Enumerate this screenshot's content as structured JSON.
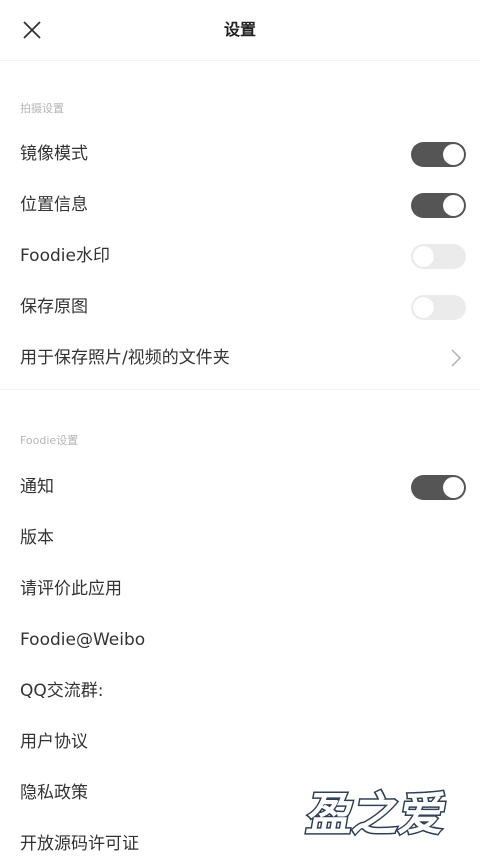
{
  "header": {
    "title": "设置",
    "close_icon": "close-icon"
  },
  "section_capture": {
    "label": "拍摄设置"
  },
  "capture_items": [
    {
      "label": "镜像模式",
      "toggle": true
    },
    {
      "label": "位置信息",
      "toggle": true
    },
    {
      "label": "Foodie水印",
      "toggle": false
    },
    {
      "label": "保存原图",
      "toggle": false
    },
    {
      "label": "用于保存照片/视频的文件夹",
      "chevron": "chevron-right-icon"
    }
  ],
  "section_foodie": {
    "label": "Foodie设置"
  },
  "foodie_items": [
    {
      "label": "通知",
      "toggle": true
    },
    {
      "label": "版本"
    },
    {
      "label": "请评价此应用"
    },
    {
      "label": "Foodie@Weibo"
    },
    {
      "label": "QQ交流群:"
    },
    {
      "label": "用户协议"
    },
    {
      "label": "隐私政策"
    },
    {
      "label": "开放源码许可证"
    }
  ],
  "watermark": {
    "text": "盈之爱"
  },
  "colors": {
    "toggle_on": "#555555",
    "toggle_off": "#ebebeb",
    "section_label": "#b5b5b5"
  }
}
